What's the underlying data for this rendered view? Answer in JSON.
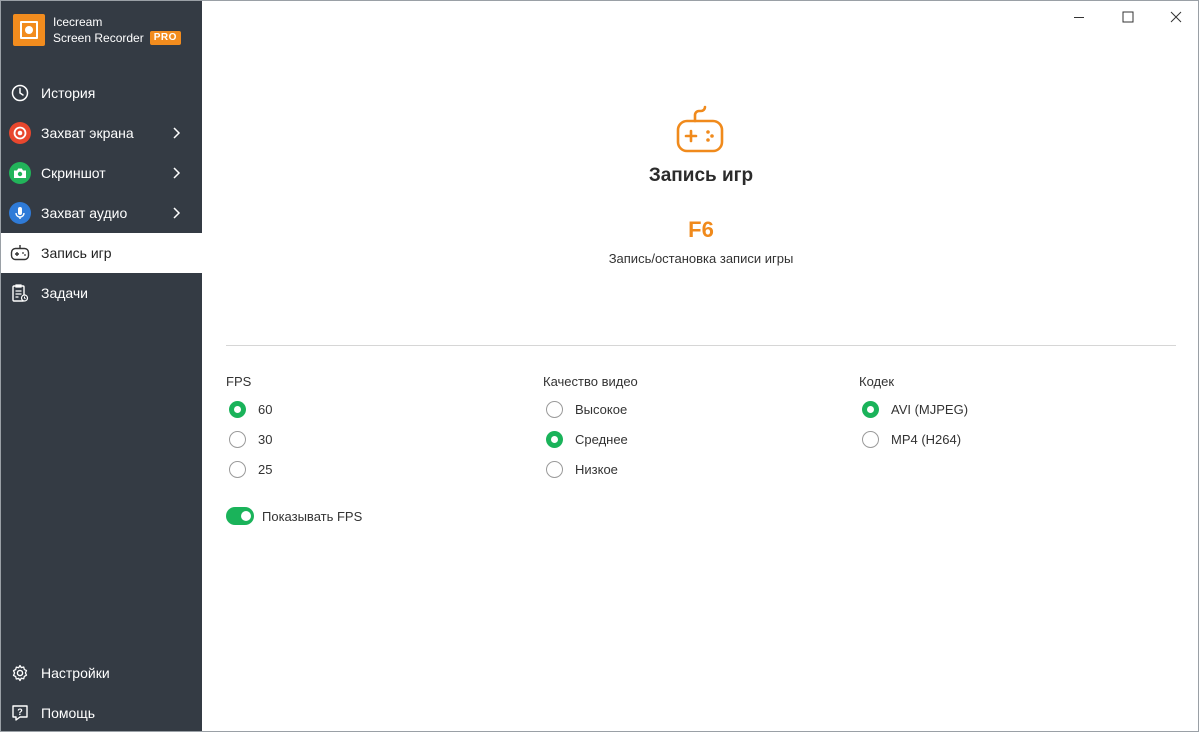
{
  "app": {
    "name_line1": "Icecream",
    "name_line2": "Screen Recorder",
    "badge": "PRO",
    "accent_color": "#f28c1e"
  },
  "sidebar": {
    "items": [
      {
        "label": "История",
        "icon": "clock-icon",
        "has_submenu": false,
        "active": false
      },
      {
        "label": "Захват экрана",
        "icon": "record-icon",
        "has_submenu": true,
        "active": false,
        "icon_color": "#e8472e"
      },
      {
        "label": "Скриншот",
        "icon": "camera-icon",
        "has_submenu": true,
        "active": false,
        "icon_color": "#22b45a"
      },
      {
        "label": "Захват аудио",
        "icon": "microphone-icon",
        "has_submenu": true,
        "active": false,
        "icon_color": "#2f7bd8"
      },
      {
        "label": "Запись игр",
        "icon": "gamepad-icon",
        "has_submenu": false,
        "active": true
      },
      {
        "label": "Задачи",
        "icon": "tasks-icon",
        "has_submenu": false,
        "active": false
      }
    ],
    "bottom": [
      {
        "label": "Настройки",
        "icon": "gear-icon"
      },
      {
        "label": "Помощь",
        "icon": "help-icon"
      }
    ]
  },
  "window_controls": [
    "minimize-icon",
    "maximize-icon",
    "close-icon"
  ],
  "main": {
    "title": "Запись игр",
    "hotkey": "F6",
    "hotkey_description": "Запись/остановка записи игры",
    "fps": {
      "label": "FPS",
      "options": [
        "60",
        "30",
        "25"
      ],
      "selected": "60"
    },
    "quality": {
      "label": "Качество видео",
      "options": [
        "Высокое",
        "Среднее",
        "Низкое"
      ],
      "selected": "Среднее"
    },
    "codec": {
      "label": "Кодек",
      "options": [
        "AVI (MJPEG)",
        "MP4 (H264)"
      ],
      "selected": "AVI (MJPEG)"
    },
    "show_fps": {
      "label": "Показывать FPS",
      "enabled": true
    },
    "selection_color": "#1ab35a"
  }
}
